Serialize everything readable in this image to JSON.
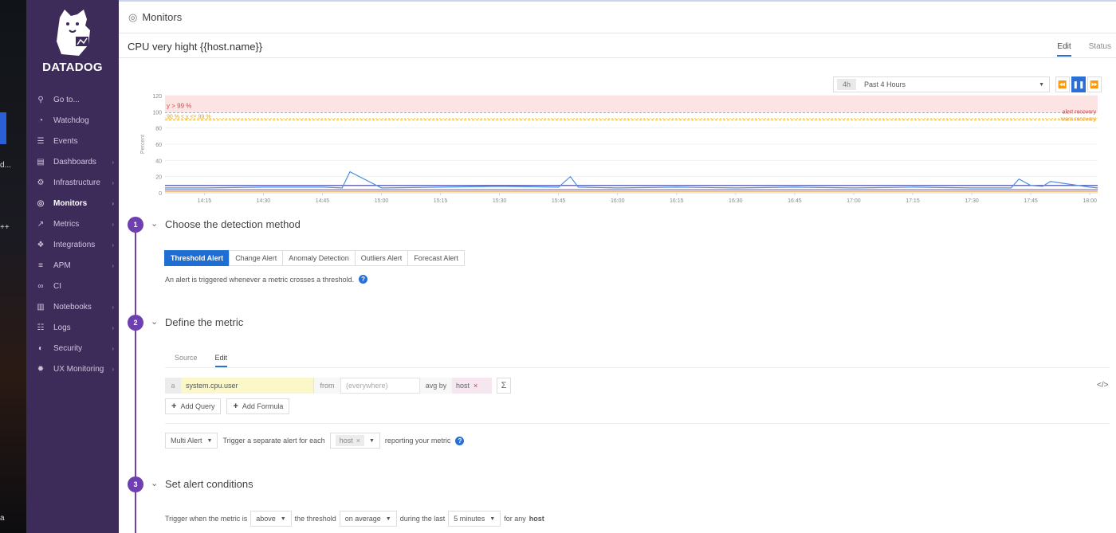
{
  "desktop": {
    "fragments": [
      "d...",
      "++",
      "a"
    ]
  },
  "sidebar": {
    "logo_text": "DATADOG",
    "items": [
      {
        "label": "Go to...",
        "icon": "search-icon"
      },
      {
        "label": "Watchdog",
        "icon": "binoculars-icon"
      },
      {
        "label": "Events",
        "icon": "events-icon"
      },
      {
        "label": "Dashboards",
        "icon": "dashboards-icon"
      },
      {
        "label": "Infrastructure",
        "icon": "infrastructure-icon"
      },
      {
        "label": "Monitors",
        "icon": "monitors-icon"
      },
      {
        "label": "Metrics",
        "icon": "metrics-icon"
      },
      {
        "label": "Integrations",
        "icon": "puzzle-icon"
      },
      {
        "label": "APM",
        "icon": "apm-icon"
      },
      {
        "label": "CI",
        "icon": "ci-icon"
      },
      {
        "label": "Notebooks",
        "icon": "notebook-icon"
      },
      {
        "label": "Logs",
        "icon": "logs-icon"
      },
      {
        "label": "Security",
        "icon": "shield-icon"
      },
      {
        "label": "UX Monitoring",
        "icon": "ux-icon"
      }
    ]
  },
  "header": {
    "title": "Monitors"
  },
  "monitor": {
    "name": "CPU very hight {{host.name}}",
    "tab_edit": "Edit",
    "tab_status": "Status"
  },
  "time": {
    "badge": "4h",
    "label": "Past 4 Hours"
  },
  "chart_data": {
    "type": "line",
    "ylabel": "Percent",
    "ylim": [
      0,
      120
    ],
    "yticks": [
      0,
      20,
      40,
      60,
      80,
      100,
      120
    ],
    "x_ticks": [
      "14:15",
      "14:30",
      "14:45",
      "15:00",
      "15:15",
      "15:30",
      "15:45",
      "16:00",
      "16:15",
      "16:30",
      "16:45",
      "17:00",
      "17:15",
      "17:30",
      "17:45",
      "18:00"
    ],
    "thresholds": {
      "alert": {
        "label": "y > 99 %",
        "value": 99,
        "band": [
          99,
          120
        ],
        "right_label": "alert recovery"
      },
      "warn": {
        "label": "90 % < y <= 99 %",
        "value": 90,
        "right_label": "warn recovery"
      }
    },
    "series": [
      {
        "color": "#4a90e2",
        "x": [
          "14:05",
          "14:15",
          "14:30",
          "14:45",
          "14:50",
          "14:52",
          "15:00",
          "15:15",
          "15:30",
          "15:45",
          "15:48",
          "15:50",
          "16:00",
          "16:15",
          "16:30",
          "16:45",
          "17:00",
          "17:15",
          "17:30",
          "17:40",
          "17:42",
          "17:45",
          "17:48",
          "17:50",
          "18:00",
          "18:02"
        ],
        "y": [
          6,
          6,
          7,
          7,
          6,
          26,
          6,
          7,
          8,
          7,
          20,
          7,
          6,
          7,
          6,
          7,
          6,
          7,
          6,
          6,
          17,
          9,
          8,
          14,
          7,
          6
        ]
      },
      {
        "color": "#3b3b9e",
        "x": [
          "14:05",
          "18:02"
        ],
        "y": [
          9,
          9
        ]
      },
      {
        "color": "#e0a030",
        "x": [
          "14:05",
          "18:02"
        ],
        "y": [
          2,
          2
        ]
      },
      {
        "color": "#9b7fd4",
        "x": [
          "14:05",
          "18:02"
        ],
        "y": [
          4,
          4
        ]
      }
    ]
  },
  "steps": [
    {
      "num": "1",
      "title": "Choose the detection method"
    },
    {
      "num": "2",
      "title": "Define the metric"
    },
    {
      "num": "3",
      "title": "Set alert conditions"
    }
  ],
  "detection": {
    "tabs": [
      "Threshold Alert",
      "Change Alert",
      "Anomaly Detection",
      "Outliers Alert",
      "Forecast Alert"
    ],
    "description": "An alert is triggered whenever a metric crosses a threshold."
  },
  "metric": {
    "tab_source": "Source",
    "tab_edit": "Edit",
    "query_letter": "a",
    "metric_name": "system.cpu.user",
    "from_label": "from",
    "from_placeholder": "(everywhere)",
    "avg_by_label": "avg by",
    "group_by": "host",
    "sigma": "Σ",
    "code_icon": "</>",
    "add_query": "Add Query",
    "add_formula": "Add Formula",
    "multi_alert": "Multi Alert",
    "trigger_text": "Trigger a separate alert for each",
    "each_chip": "host",
    "reporting_text": "reporting your metric"
  },
  "conditions": {
    "prefix": "Trigger when the metric is",
    "comparator": "above",
    "mid1": "the threshold",
    "aggregation": "on average",
    "mid2": "during the last",
    "window": "5 minutes",
    "mid3": "for any",
    "group": "host"
  }
}
